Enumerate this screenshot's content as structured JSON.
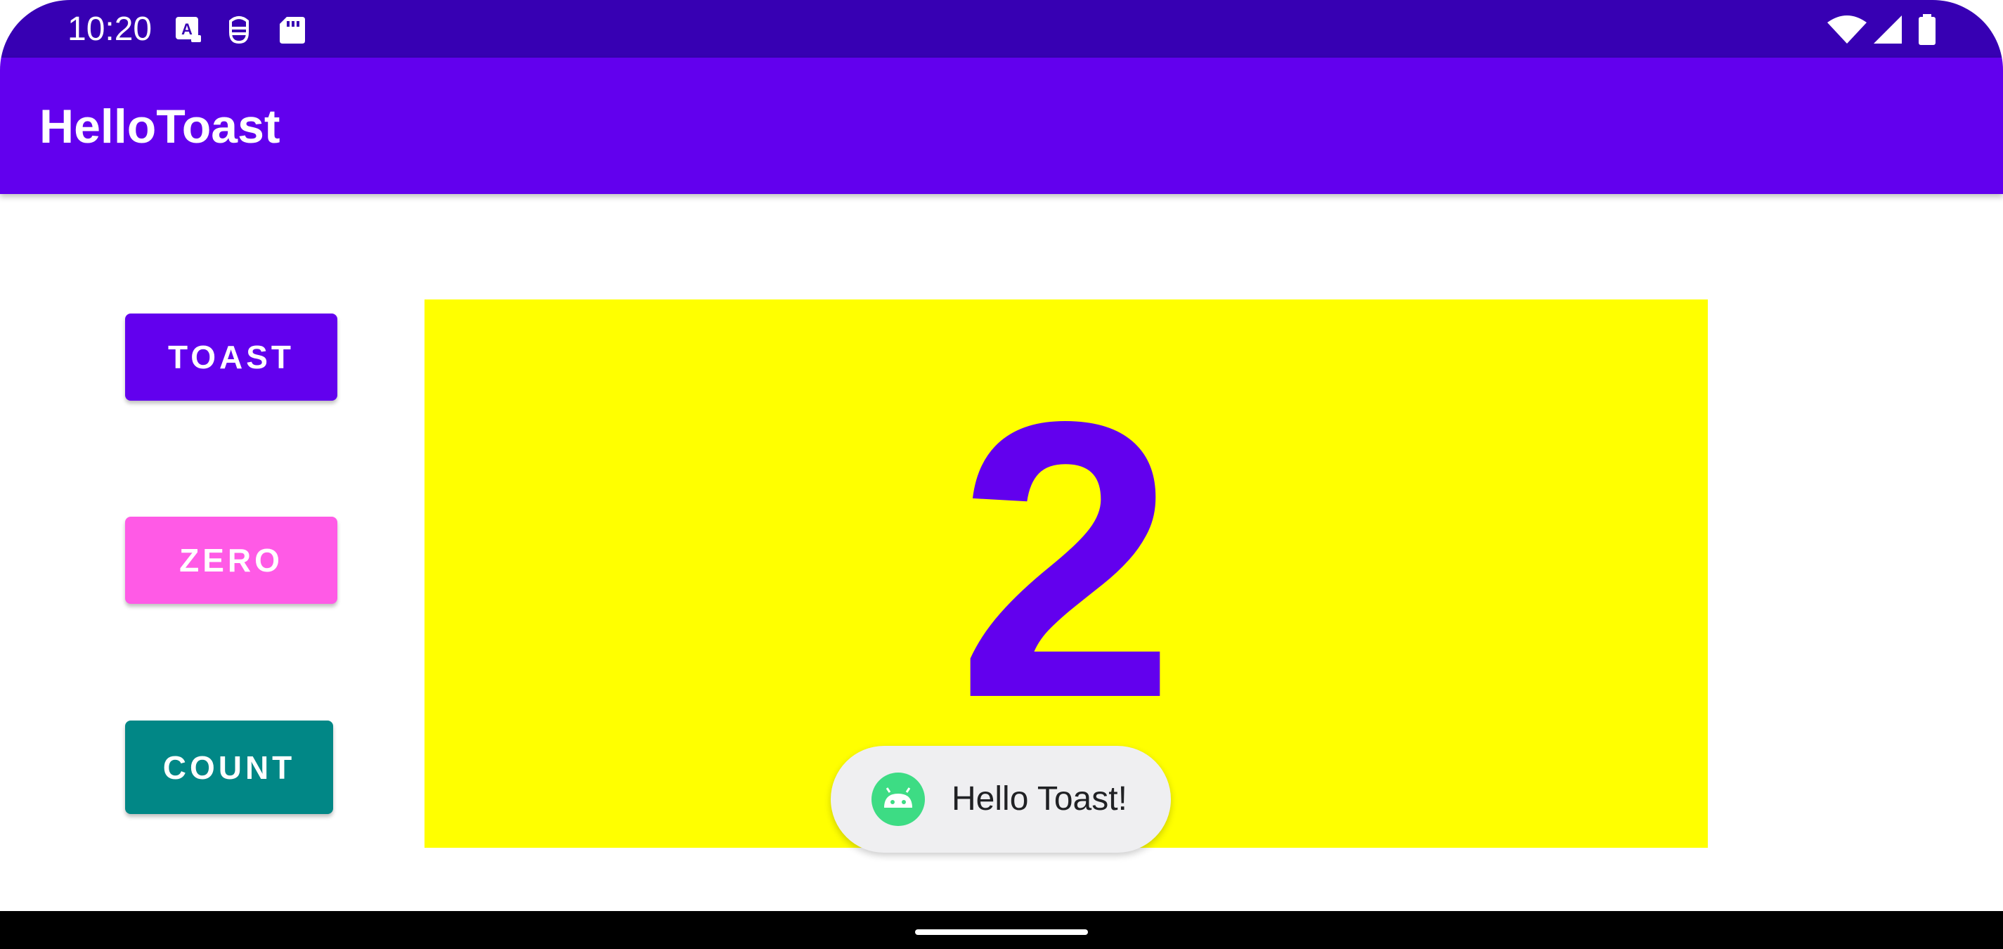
{
  "status_bar": {
    "time": "10:20",
    "left_icons": [
      "a-notification-icon",
      "android-debug-icon",
      "sd-card-icon"
    ],
    "right_icons": [
      "wifi-icon",
      "cell-signal-icon",
      "battery-icon"
    ],
    "color": "#3700B3"
  },
  "app_bar": {
    "title": "HelloToast",
    "color": "#6200EE"
  },
  "buttons": {
    "toast": {
      "label": "TOAST",
      "color": "#6200EE"
    },
    "zero": {
      "label": "ZERO",
      "color": "#FF5AE6"
    },
    "count": {
      "label": "COUNT",
      "color": "#018786"
    }
  },
  "count_panel": {
    "value": "2",
    "background": "#FFFF00",
    "text_color": "#6200EE"
  },
  "toast": {
    "message": "Hello Toast!",
    "icon": "android-app-icon"
  },
  "nav_bar": {
    "handle": "home-handle"
  }
}
